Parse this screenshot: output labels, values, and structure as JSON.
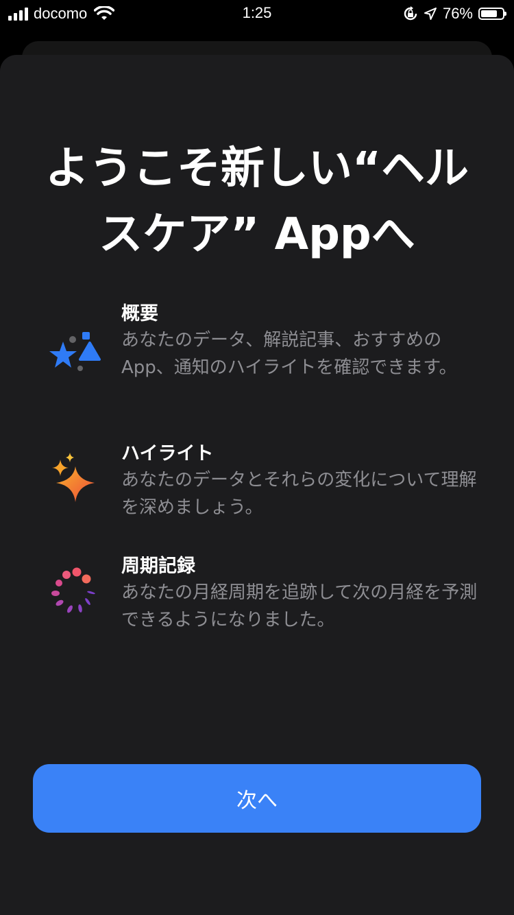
{
  "status_bar": {
    "carrier": "docomo",
    "time": "1:25",
    "battery_percent": "76%",
    "battery_level": 0.76,
    "icons": [
      "signal-icon",
      "wifi-icon",
      "rotation-lock-icon",
      "location-icon",
      "battery-icon"
    ]
  },
  "title": "ようこそ新しい“ヘルスケア” Appへ",
  "features": [
    {
      "title": "概要",
      "description": "あなたのデータ、解説記事、おすすめのApp、通知のハイライトを確認できます。",
      "icon": "summary-icon"
    },
    {
      "title": "ハイライト",
      "description": "あなたのデータとそれらの変化について理解を深めましょう。",
      "icon": "sparkle-icon"
    },
    {
      "title": "周期記録",
      "description": "あなたの月経周期を追跡して次の月経を予測できるようになりました。",
      "icon": "cycle-tracking-icon"
    }
  ],
  "next_button": {
    "label": "次へ"
  },
  "colors": {
    "accent": "#3a82f7",
    "background": "#1c1c1e",
    "secondary_text": "#8e8e93",
    "summary_blue": "#2f7bf6",
    "highlight_orange": "#f0652f"
  }
}
